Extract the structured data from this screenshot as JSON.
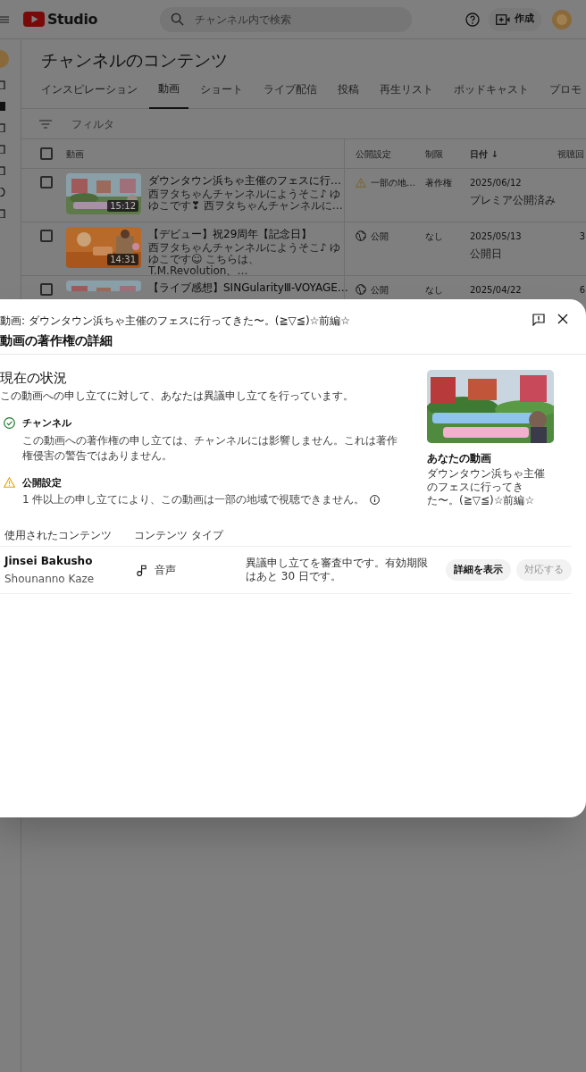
{
  "header": {
    "logo": "Studio",
    "search": {
      "placeholder": "チャンネル内で検索"
    },
    "create_button": "作成"
  },
  "page": {
    "title": "チャンネルのコンテンツ",
    "tabs": [
      {
        "label": "インスピレーション",
        "selected": false
      },
      {
        "label": "動画",
        "selected": true
      },
      {
        "label": "ショート",
        "selected": false
      },
      {
        "label": "ライブ配信",
        "selected": false
      },
      {
        "label": "投稿",
        "selected": false
      },
      {
        "label": "再生リスト",
        "selected": false
      },
      {
        "label": "ポッドキャスト",
        "selected": false
      },
      {
        "label": "プロモ",
        "selected": false
      }
    ],
    "filter": {
      "placeholder": "フィルタ"
    },
    "table": {
      "select_all_checked": false,
      "columns": [
        "動画",
        "公開設定",
        "制限",
        "日付 ↓",
        "視聴回"
      ],
      "rows": [
        {
          "checked": false,
          "duration": "15:12",
          "title": "ダウンタウン浜ちゃ主催のフェスに行…",
          "description": "西ヲタちゃんチャンネルにようそこ♪ ゆゆこです❣ 西ヲタちゃんチャンネルに…",
          "kind": "restricted",
          "visibility": "一部の地…",
          "restriction": "著作権",
          "date": "2025/06/12",
          "date_note": "プレミア公開済み"
        },
        {
          "checked": false,
          "duration": "14:31",
          "title": "【デビュー】祝29周年【記念日】",
          "description": "西ヲタちゃんチャンネルにようそこ♪ ゆゆこです☺ こちらは、T.M.Revolution、…",
          "kind": "public",
          "visibility": "公開",
          "restriction": "なし",
          "date": "2025/05/13",
          "date_note": "公開日",
          "views": "3"
        },
        {
          "checked": false,
          "title": "【ライブ感想】SINGularityⅢ-VOYAGE…",
          "kind": "public",
          "visibility": "公開",
          "restriction": "なし",
          "date": "2025/04/22",
          "views": "6"
        }
      ]
    }
  },
  "dialog": {
    "subtitle": "動画: ダウンタウン浜ちゃ主催のフェスに行ってきた〜。(≧▽≦)☆前編☆",
    "title": "動画の著作権の詳細",
    "status_heading": "現在の状況",
    "status_text": "この動画への申し立てに対して、あなたは異議申し立てを行っています。",
    "status_items": [
      {
        "kind": "ok",
        "title": "チャンネル",
        "text": "この動画への著作権の申し立ては、チャンネルには影響しません。これは著作権侵害の警告ではありません。"
      },
      {
        "kind": "warning",
        "title": "公開設定",
        "text": "1 件以上の申し立てにより、この動画は一部の地域で視聴できません。",
        "info": true
      }
    ],
    "your_video": {
      "label": "あなたの動画",
      "title": "ダウンタウン浜ちゃ主催のフェスに行ってきた〜。(≧▽≦)☆前編☆"
    },
    "claims": {
      "columns": [
        "使用されたコンテンツ",
        "コンテンツ タイプ"
      ],
      "rows": [
        {
          "title": "Jinsei Bakusho",
          "artist": "Shounanno Kaze",
          "type": "音声",
          "status": "異議申し立てを審査中です。有効期限はあと 30 日です。",
          "buttons": [
            {
              "label": "詳細を表示",
              "disabled": false
            },
            {
              "label": "対応する",
              "disabled": true
            }
          ]
        }
      ]
    }
  }
}
